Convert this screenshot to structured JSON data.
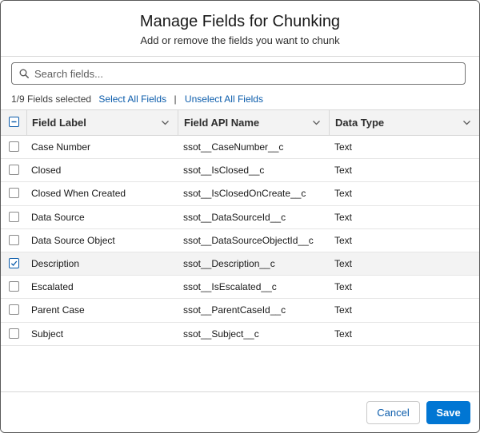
{
  "modal": {
    "title": "Manage Fields for Chunking",
    "subtitle": "Add or remove the fields you want to chunk"
  },
  "search": {
    "placeholder": "Search fields...",
    "value": ""
  },
  "selection": {
    "count_text": "1/9 Fields selected",
    "select_all": "Select All Fields",
    "unselect_all": "Unselect All Fields",
    "separator": "|"
  },
  "table": {
    "headers": {
      "label": "Field Label",
      "api": "Field API Name",
      "type": "Data Type"
    },
    "rows": [
      {
        "label": "Case Number",
        "api": "ssot__CaseNumber__c",
        "type": "Text",
        "checked": false
      },
      {
        "label": "Closed",
        "api": "ssot__IsClosed__c",
        "type": "Text",
        "checked": false
      },
      {
        "label": "Closed When Created",
        "api": "ssot__IsClosedOnCreate__c",
        "type": "Text",
        "checked": false
      },
      {
        "label": "Data Source",
        "api": "ssot__DataSourceId__c",
        "type": "Text",
        "checked": false
      },
      {
        "label": "Data Source Object",
        "api": "ssot__DataSourceObjectId__c",
        "type": "Text",
        "checked": false
      },
      {
        "label": "Description",
        "api": "ssot__Description__c",
        "type": "Text",
        "checked": true
      },
      {
        "label": "Escalated",
        "api": "ssot__IsEscalated__c",
        "type": "Text",
        "checked": false
      },
      {
        "label": "Parent Case",
        "api": "ssot__ParentCaseId__c",
        "type": "Text",
        "checked": false
      },
      {
        "label": "Subject",
        "api": "ssot__Subject__c",
        "type": "Text",
        "checked": false
      }
    ]
  },
  "footer": {
    "cancel_label": "Cancel",
    "save_label": "Save"
  },
  "colors": {
    "brand": "#0176d3",
    "link": "#0b5cab"
  },
  "icons": {
    "search": "search-icon",
    "sort": "chevron-down-icon",
    "check": "checkmark-icon",
    "indeterminate": "minus-icon"
  }
}
